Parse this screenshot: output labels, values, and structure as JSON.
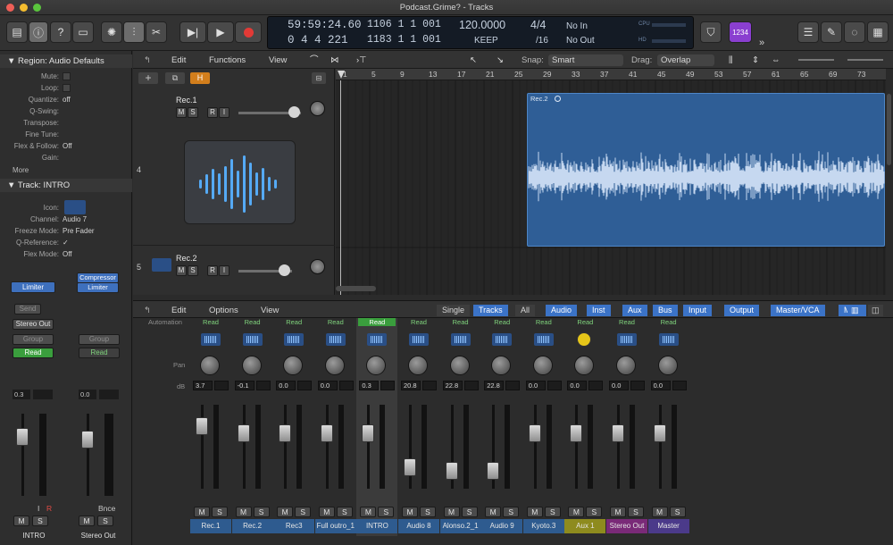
{
  "window": {
    "title": "Podcast.Grime? - Tracks"
  },
  "lcd": {
    "time": "59:59:24.60",
    "bars": "0  4  4  221",
    "pos_a": "1106  1  1  001",
    "pos_b": "1183  1  1  001",
    "tempo": "120.0000",
    "tempo_mode": "KEEP",
    "sig_top": "4/4",
    "sig_bottom": "/16",
    "in": "No In",
    "out": "No Out",
    "cpu_label": "CPU",
    "hd_label": "HD"
  },
  "toolbar": {
    "badge": "1234"
  },
  "inspector": {
    "region_header": "Region: Audio Defaults",
    "region_rows": [
      {
        "label": "Mute:",
        "value": ""
      },
      {
        "label": "Loop:",
        "value": ""
      },
      {
        "label": "Quantize:",
        "value": "off"
      },
      {
        "label": "Q-Swing:",
        "value": ""
      },
      {
        "label": "Transpose:",
        "value": ""
      },
      {
        "label": "Fine Tune:",
        "value": ""
      },
      {
        "label": "Flex & Follow:",
        "value": "Off"
      },
      {
        "label": "Gain:",
        "value": ""
      }
    ],
    "more": "More",
    "track_header": "Track:  INTRO",
    "track_rows": [
      {
        "label": "Icon:",
        "value": ""
      },
      {
        "label": "Channel:",
        "value": "Audio 7"
      },
      {
        "label": "Freeze Mode:",
        "value": "Pre Fader"
      },
      {
        "label": "Q-Reference:",
        "value": "✓"
      },
      {
        "label": "Flex Mode:",
        "value": "Off"
      }
    ],
    "strip_left": {
      "plugin": "Limiter",
      "send": "Send",
      "output": "Stereo Out",
      "group": "Group",
      "auto": "Read",
      "vol": "0.3",
      "name": "INTRO",
      "i": "I",
      "r": "R",
      "m": "M",
      "s": "S"
    },
    "strip_right": {
      "plugin1": "Compressor",
      "plugin2": "Limiter",
      "group": "Group",
      "auto": "Read",
      "vol": "0.0",
      "name": "Stereo Out",
      "bnce": "Bnce",
      "m": "M",
      "s": "S"
    }
  },
  "tracks_header": {
    "edit": "Edit",
    "functions": "Functions",
    "view": "View",
    "snap_label": "Snap:",
    "snap": "Smart",
    "drag_label": "Drag:",
    "drag": "Overlap"
  },
  "ruler": [
    "1",
    "5",
    "9",
    "13",
    "17",
    "21",
    "25",
    "29",
    "33",
    "37",
    "41",
    "45",
    "49",
    "53",
    "57",
    "61",
    "65",
    "69",
    "73"
  ],
  "tracks": [
    {
      "num": "4",
      "name": "Rec.1",
      "m": "M",
      "s": "S",
      "r": "R",
      "i": "I"
    },
    {
      "num": "5",
      "name": "Rec.2",
      "m": "M",
      "s": "S",
      "r": "R",
      "i": "I"
    }
  ],
  "region": {
    "name": "Rec.2"
  },
  "mixer_header": {
    "edit": "Edit",
    "options": "Options",
    "view": "View",
    "single": "Single",
    "tracks": "Tracks",
    "all": "All",
    "filters": [
      "Audio",
      "Inst",
      "Aux",
      "Bus",
      "Input",
      "Output",
      "Master/VCA",
      "MIDI"
    ]
  },
  "mixer_labels": {
    "automation": "Automation",
    "pan": "Pan",
    "db": "dB"
  },
  "channels": [
    {
      "name": "Rec.1",
      "auto": "Read",
      "db": "3.7",
      "fader": 0.82,
      "color": "#2e5b8f"
    },
    {
      "name": "Rec.2",
      "auto": "Read",
      "db": "-0.1",
      "fader": 0.72,
      "color": "#2e5b8f"
    },
    {
      "name": "Rec3",
      "auto": "Read",
      "db": "0.0",
      "fader": 0.72,
      "color": "#2e5b8f"
    },
    {
      "name": "Full outro_1",
      "auto": "Read",
      "db": "0.0",
      "fader": 0.72,
      "color": "#2e5b8f"
    },
    {
      "name": "INTRO",
      "auto": "Read",
      "db": "0.3",
      "fader": 0.72,
      "color": "#2e5b8f"
    },
    {
      "name": "Audio 8",
      "auto": "Read",
      "db": "20.8",
      "fader": 0.25,
      "color": "#2e5b8f"
    },
    {
      "name": "Alonso.2_1",
      "auto": "Read",
      "db": "22.8",
      "fader": 0.2,
      "color": "#2e5b8f"
    },
    {
      "name": "Audio 9",
      "auto": "Read",
      "db": "22.8",
      "fader": 0.2,
      "color": "#2e5b8f"
    },
    {
      "name": "Kyoto.3",
      "auto": "Read",
      "db": "0.0",
      "fader": 0.72,
      "color": "#2e5b8f"
    },
    {
      "name": "Aux 1",
      "auto": "Read",
      "db": "0.0",
      "fader": 0.72,
      "color": "#8e8b1e"
    },
    {
      "name": "Stereo Out",
      "auto": "Read",
      "db": "0.0",
      "fader": 0.72,
      "color": "#7a2a78"
    },
    {
      "name": "Master",
      "auto": "Read",
      "db": "0.0",
      "fader": 0.72,
      "color": "#4b3a8a"
    }
  ],
  "colors": {
    "accent": "#3b73c7",
    "region": "#2f5e96",
    "read_green": "#4fb548"
  }
}
